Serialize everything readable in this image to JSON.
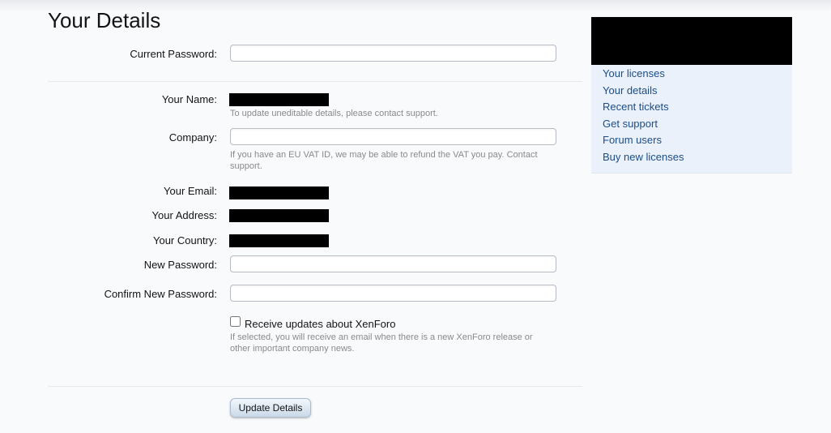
{
  "page": {
    "title": "Your Details"
  },
  "form": {
    "current_password": {
      "label": "Current Password:",
      "value": "",
      "placeholder": ""
    },
    "name": {
      "label": "Your Name:",
      "hint": "To update uneditable details, please contact support."
    },
    "company": {
      "label": "Company:",
      "value": "",
      "placeholder": "",
      "hint": "If you have an EU VAT ID, we may be able to refund the VAT you pay. Contact support."
    },
    "email": {
      "label": "Your Email:"
    },
    "address": {
      "label": "Your Address:"
    },
    "country": {
      "label": "Your Country:"
    },
    "new_password": {
      "label": "New Password:",
      "value": "",
      "placeholder": ""
    },
    "confirm_password": {
      "label": "Confirm New Password:",
      "value": "",
      "placeholder": ""
    },
    "updates": {
      "label": "Receive updates about XenForo",
      "checked": false,
      "hint": "If selected, you will receive an email when there is a new XenForo release or other important company news."
    },
    "submit_label": "Update Details"
  },
  "sidebar": {
    "items": [
      {
        "label": "Your licenses"
      },
      {
        "label": "Your details"
      },
      {
        "label": "Recent tickets"
      },
      {
        "label": "Get support"
      },
      {
        "label": "Forum users"
      },
      {
        "label": "Buy new licenses"
      }
    ]
  },
  "colors": {
    "background": "#f9fafc",
    "sidebar_bg": "#eaf1fa",
    "link": "#1c4d86",
    "hint_text": "#8a8a8a"
  }
}
